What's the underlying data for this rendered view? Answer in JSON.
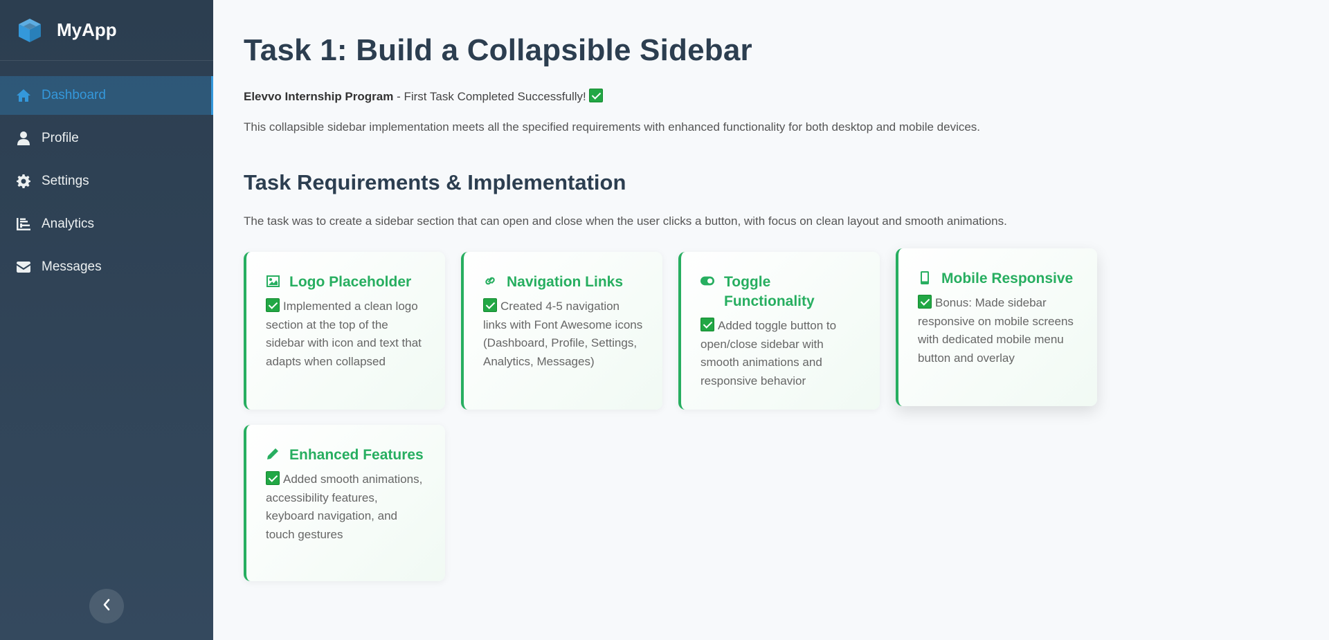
{
  "app": {
    "name": "MyApp"
  },
  "sidebar": {
    "items": [
      {
        "label": "Dashboard",
        "icon": "home-icon",
        "active": true
      },
      {
        "label": "Profile",
        "icon": "user-icon",
        "active": false
      },
      {
        "label": "Settings",
        "icon": "gear-icon",
        "active": false
      },
      {
        "label": "Analytics",
        "icon": "chart-icon",
        "active": false
      },
      {
        "label": "Messages",
        "icon": "envelope-icon",
        "active": false
      }
    ],
    "toggle_icon": "chevron-left-icon"
  },
  "main": {
    "title": "Task 1: Build a Collapsible Sidebar",
    "intro_bold": "Elevvo Internship Program",
    "intro_rest": " - First Task Completed Successfully! ",
    "description": "This collapsible sidebar implementation meets all the specified requirements with enhanced functionality for both desktop and mobile devices.",
    "section_title": "Task Requirements & Implementation",
    "section_desc": "The task was to create a sidebar section that can open and close when the user clicks a button, with focus on clean layout and smooth animations.",
    "cards": [
      {
        "title": "Logo Placeholder",
        "icon": "image-icon",
        "text": "Implemented a clean logo section at the top of the sidebar with icon and text that adapts when collapsed"
      },
      {
        "title": "Navigation Links",
        "icon": "link-icon",
        "text": "Created 4-5 navigation links with Font Awesome icons (Dashboard, Profile, Settings, Analytics, Messages)"
      },
      {
        "title": "Toggle Functionality",
        "icon": "toggle-icon",
        "text": "Added toggle button to open/close sidebar with smooth animations and responsive behavior"
      },
      {
        "title": "Mobile Responsive",
        "icon": "mobile-icon",
        "text": "Bonus: Made sidebar responsive on mobile screens with dedicated mobile menu button and overlay"
      },
      {
        "title": "Enhanced Features",
        "icon": "pencil-icon",
        "text": "Added smooth animations, accessibility features, keyboard navigation, and touch gestures"
      }
    ]
  },
  "colors": {
    "sidebar_bg": "#2c3e50",
    "accent": "#3498db",
    "success": "#27ae60"
  }
}
